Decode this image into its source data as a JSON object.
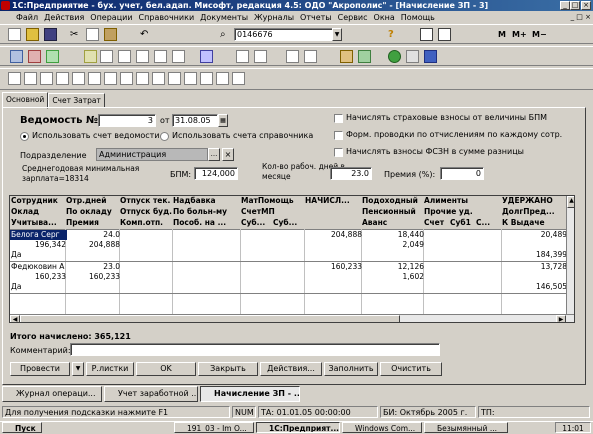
{
  "window": {
    "title": "1С:Предприятие - бух. учет, бел.адап. Мисофт, редакция 4.5: ОДО \"Акрополис\" - [Начисление ЗП - 3]"
  },
  "menu": [
    "Файл",
    "Действия",
    "Операции",
    "Справочники",
    "Документы",
    "Журналы",
    "Отчеты",
    "Сервис",
    "Окна",
    "Помощь"
  ],
  "toolbar": {
    "search_value": "0146676",
    "right_labels": [
      "M",
      "M+",
      "M−"
    ]
  },
  "tabs": [
    "Основной",
    "Счет Затрат"
  ],
  "form": {
    "doc_label": "Ведомость №",
    "doc_number": "3",
    "date_label": "от",
    "date_value": "31.08.05",
    "radio1": "Использовать счет ведомости",
    "radio2": "Использовать счета справочника",
    "dept_label": "Подразделение",
    "dept_value": "Администрация",
    "min_wage_label": "Среднегодовая минимальная зарплата=18314",
    "bpm_label": "БПМ:",
    "bpm_value": "124,000",
    "workdays_label": "Кол-во рабоч. дней в месяце",
    "workdays_value": "23.0",
    "bonus_label": "Премия (%):",
    "bonus_value": "0",
    "check1": "Начислять страховые взносы от величины БПМ",
    "check2": "Форм. проводки по отчислениям по каждому сотр.",
    "check3": "Начислять взносы ФСЗН в сумме разницы"
  },
  "grid": {
    "headers": {
      "c1": [
        "Сотрудник",
        "Оклад",
        "Учитыва..."
      ],
      "c2": [
        "Отр.дней",
        "По окладу",
        "Премия"
      ],
      "c3": [
        "Отпуск тек.",
        "Отпуск буд.",
        "Комп.отп."
      ],
      "c4": [
        "Надбавка",
        "По больн-му",
        "Пособ. на ..."
      ],
      "c5": [
        "МатПомощь",
        "СчетМП",
        "Суб...",
        "Суб..."
      ],
      "c6": [
        "НАЧИСЛ..."
      ],
      "c7": [
        "Подоходный",
        "Пенсионный",
        "Аванс"
      ],
      "c8": [
        "Алименты",
        "Прочие уд.",
        "Счет",
        "Суб1",
        "С..."
      ],
      "c9": [
        "УДЕРЖАНО",
        "ДолгПред...",
        "К Выдаче"
      ]
    },
    "rows": [
      {
        "name": "Белога Серг",
        "oklad": "196,342",
        "flag": "Да",
        "days": "24.0",
        "po_okl": "204,888",
        "accrued": "204,888",
        "income_tax": "18,440",
        "pension": "2,049",
        "withheld": "20,489",
        "payout": "184,399"
      },
      {
        "name": "Федюковин А",
        "oklad": "160,233",
        "flag": "Да",
        "days": "23.0",
        "po_okl": "160,233",
        "accrued": "160,233",
        "income_tax": "12,126",
        "pension": "1,602",
        "withheld": "13,728",
        "payout": "146,505"
      }
    ]
  },
  "totals": {
    "label": "Итого начислено: 365,121"
  },
  "comment": {
    "label": "Комментарий:",
    "value": ""
  },
  "buttons": {
    "post": "Провести",
    "payslips": "Р.листки",
    "ok": "OK",
    "close": "Закрыть",
    "actions": "Действия...",
    "fill": "Заполнить",
    "clear": "Очистить"
  },
  "doc_tabs": [
    "Журнал операци...",
    "Учет заработной ...",
    "Начисление ЗП - ..."
  ],
  "statusbar": {
    "hint": "Для получения подсказки нажмите F1",
    "num": "NUM",
    "ta": "ТА: 01.01.05 00:00:00",
    "bi": "БИ: Октябрь 2005 г.",
    "tp": "ТП:"
  },
  "taskbar": {
    "start": "Пуск",
    "items": [
      "191_03 - Im O...",
      "1С:Предприят...",
      "Windows Com...",
      "Безымянный ..."
    ],
    "clock": "11:01"
  },
  "colors": {
    "title_start": "#0a246a",
    "title_end": "#3a6ea5",
    "face": "#d4d0c8",
    "selected_row": "#0a246a"
  }
}
